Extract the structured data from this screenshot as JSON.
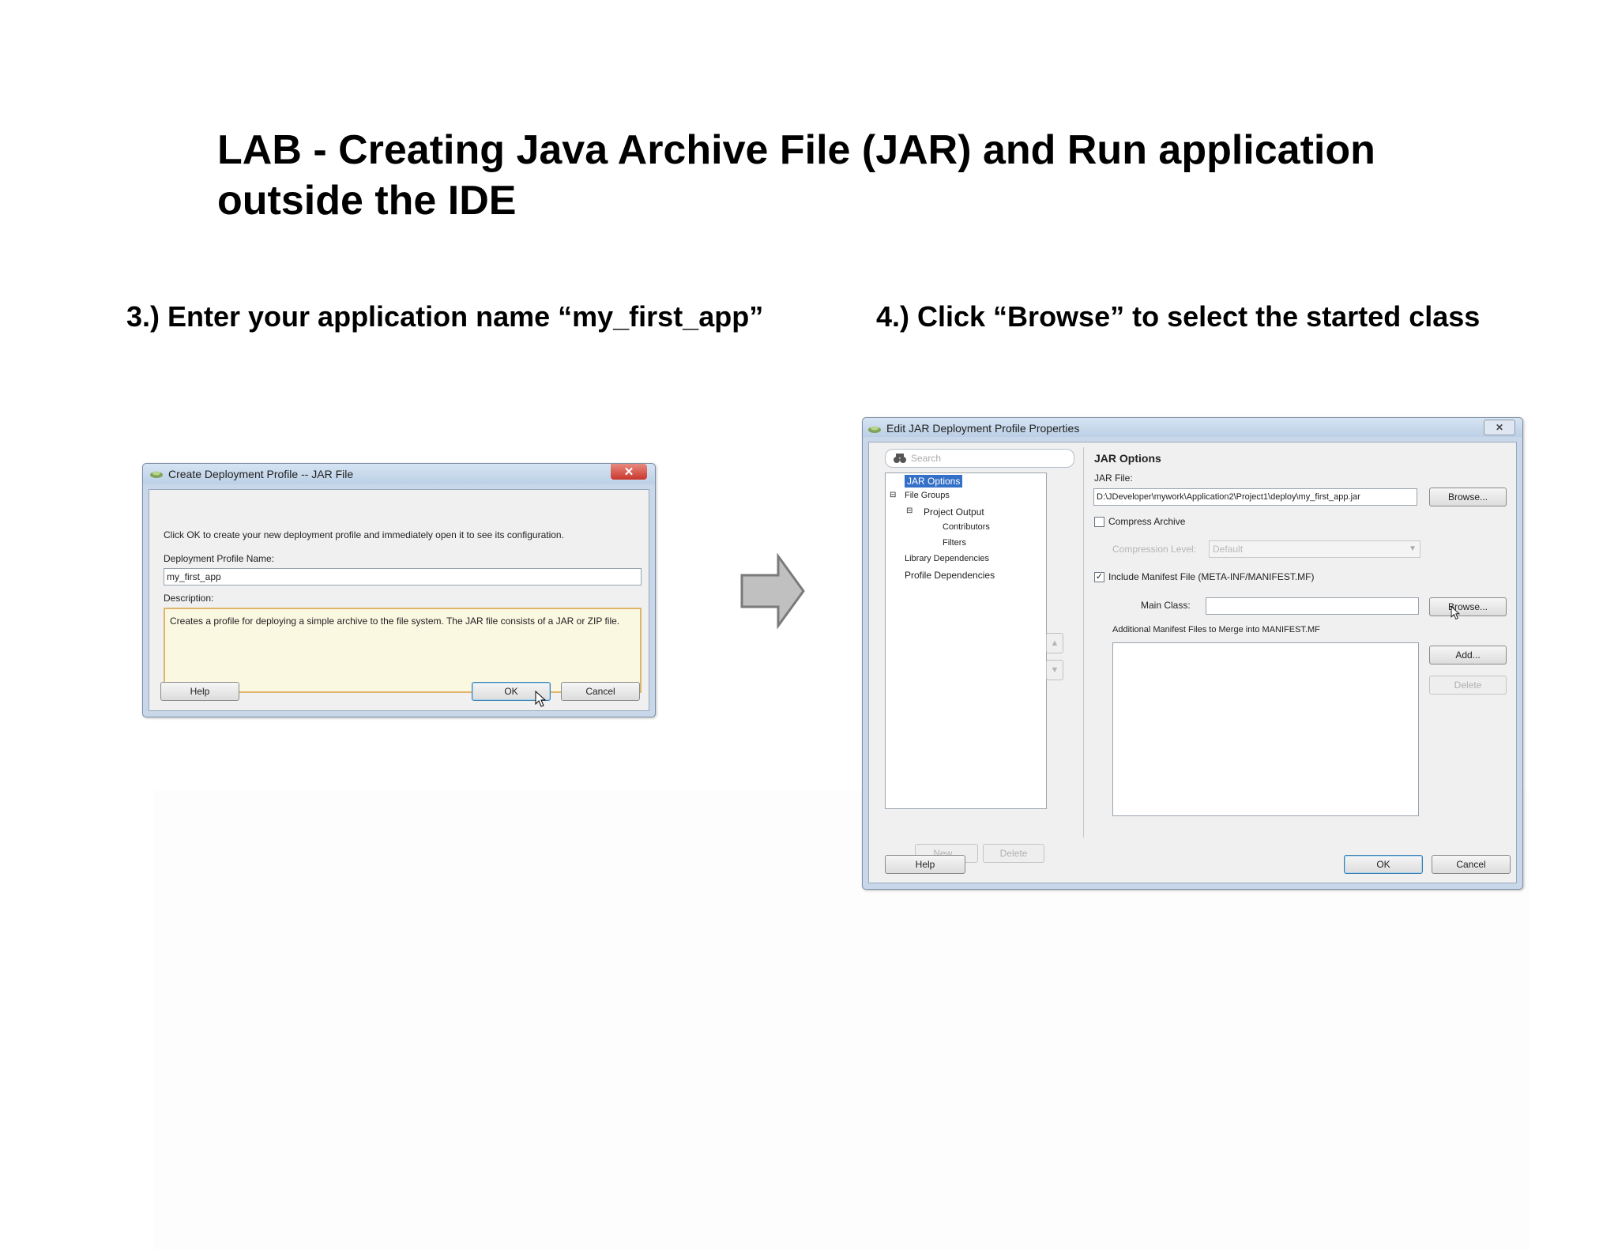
{
  "slide": {
    "title": "LAB - Creating Java Archive File (JAR) and Run application outside the IDE",
    "step3": "3.) Enter your application name “my_first_app”",
    "step4": "4.) Click “Browse” to select the started class"
  },
  "dialog1": {
    "title": "Create Deployment Profile -- JAR File",
    "instruction": "Click OK to create your new deployment profile and immediately open it to see its configuration.",
    "profile_name_label": "Deployment Profile Name:",
    "profile_name_value": "my_first_app",
    "description_label": "Description:",
    "description_text": "Creates a profile for deploying a simple archive to the file system. The JAR file consists of a JAR or ZIP file.",
    "help_label": "Help",
    "ok_label": "OK",
    "cancel_label": "Cancel"
  },
  "dialog2": {
    "title": "Edit JAR Deployment Profile Properties",
    "search_placeholder": "Search",
    "tree": {
      "jar_options": "JAR Options",
      "file_groups": "File Groups",
      "project_output": "Project Output",
      "contributors": "Contributors",
      "filters": "Filters",
      "library_dependencies": "Library Dependencies",
      "profile_dependencies": "Profile Dependencies"
    },
    "new_label": "New...",
    "delete_label": "Delete",
    "section_title": "JAR Options",
    "jar_file_label": "JAR File:",
    "jar_file_value": "D:\\JDeveloper\\mywork\\Application2\\Project1\\deploy\\my_first_app.jar",
    "browse_label": "Browse...",
    "compress_label": "Compress Archive",
    "compression_level_label": "Compression Level:",
    "compression_level_value": "Default",
    "include_manifest_label": "Include Manifest File (META-INF/MANIFEST.MF)",
    "main_class_label": "Main Class:",
    "main_class_value": "",
    "main_browse_label": "Browse...",
    "additional_label": "Additional Manifest Files to Merge into MANIFEST.MF",
    "add_label": "Add...",
    "remove_label": "Delete",
    "help_label": "Help",
    "ok_label": "OK",
    "cancel_label": "Cancel"
  },
  "colors": {
    "selection": "#3470c8",
    "close_button": "#d9473e",
    "arrow_fill": "#c0c0c0"
  }
}
